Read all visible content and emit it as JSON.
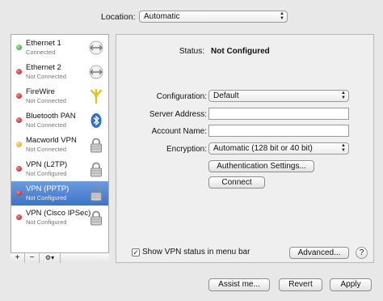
{
  "location": {
    "label": "Location:",
    "value": "Automatic"
  },
  "services": [
    {
      "name": "Ethernet 1",
      "status": "Connected",
      "dot": "green",
      "icon": "ethernet-arrows-icon",
      "selected": false
    },
    {
      "name": "Ethernet 2",
      "status": "Not Connected",
      "dot": "red",
      "icon": "ethernet-arrows-icon",
      "selected": false
    },
    {
      "name": "FireWire",
      "status": "Not Connected",
      "dot": "red",
      "icon": "firewire-icon",
      "selected": false
    },
    {
      "name": "Bluetooth PAN",
      "status": "Not Connected",
      "dot": "red",
      "icon": "bluetooth-icon",
      "selected": false
    },
    {
      "name": "Macworld VPN",
      "status": "Not Connected",
      "dot": "amber",
      "icon": "lock-icon",
      "selected": false
    },
    {
      "name": "VPN (L2TP)",
      "status": "Not Configured",
      "dot": "red",
      "icon": "lock-icon",
      "selected": false
    },
    {
      "name": "VPN (PPTP)",
      "status": "Not Configured",
      "dot": "red",
      "icon": "lock-icon",
      "selected": true
    },
    {
      "name": "VPN (Cisco IPSec)",
      "status": "Not Configured",
      "dot": "red",
      "icon": "lock-icon",
      "selected": false
    }
  ],
  "sidebar_footer": {
    "add": "+",
    "remove": "−",
    "action": "⚙▾"
  },
  "panel": {
    "status_label": "Status:",
    "status_value": "Not Configured",
    "configuration_label": "Configuration:",
    "configuration_value": "Default",
    "server_address_label": "Server Address:",
    "server_address_value": "",
    "account_name_label": "Account Name:",
    "account_name_value": "",
    "encryption_label": "Encryption:",
    "encryption_value": "Automatic (128 bit or 40 bit)",
    "auth_settings_label": "Authentication Settings...",
    "connect_label": "Connect",
    "show_vpn_label": "Show VPN status in menu bar",
    "show_vpn_checked": true,
    "advanced_label": "Advanced...",
    "help_label": "?"
  },
  "bottom": {
    "assist": "Assist me...",
    "revert": "Revert",
    "apply": "Apply"
  },
  "colors": {
    "selection": "#3f73c6",
    "connected": "#2ea12a",
    "disconnected": "#b11515",
    "pending": "#d49a10",
    "bluetooth": "#2a6fd6",
    "firewire": "#e8c21a"
  }
}
